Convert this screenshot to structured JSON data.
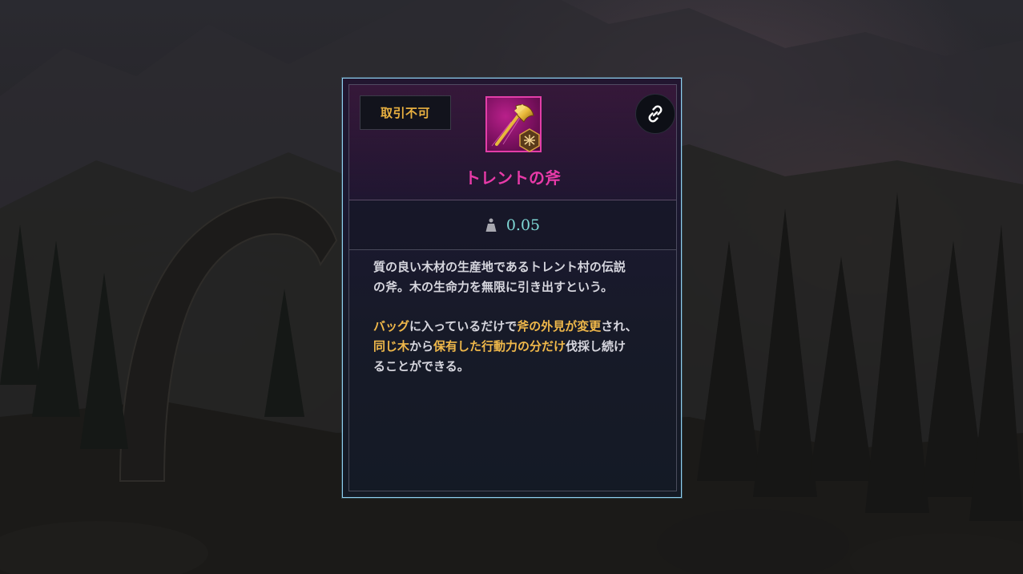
{
  "item": {
    "trade_badge": "取引不可",
    "name": "トレント の斧",
    "name_display": "トレントの斧",
    "weight": "0.05",
    "description_lines": [
      "質の良い木材の生産地であるトレント村の伝説",
      "の斧。木の生命力を無限に引き出すという。"
    ],
    "effect": {
      "p1": "バッグ",
      "p2": "に入っているだけで",
      "p3": "斧の外見が変更",
      "p4": "され、",
      "p5": "同じ木",
      "p6": "から",
      "p7": "保有した行動力の分だけ",
      "p8": "伐採し続け",
      "p9": "ることができる。"
    }
  },
  "icons": {
    "item": "axe-icon",
    "grade": "grade-emblem-icon",
    "link": "link-icon",
    "weight": "weight-icon"
  },
  "colors": {
    "border": "#8fd0f0",
    "item_name": "#e83aa8",
    "highlight": "#f0b84a",
    "weight_value": "#7fd8d6",
    "badge_text": "#e8b040"
  }
}
